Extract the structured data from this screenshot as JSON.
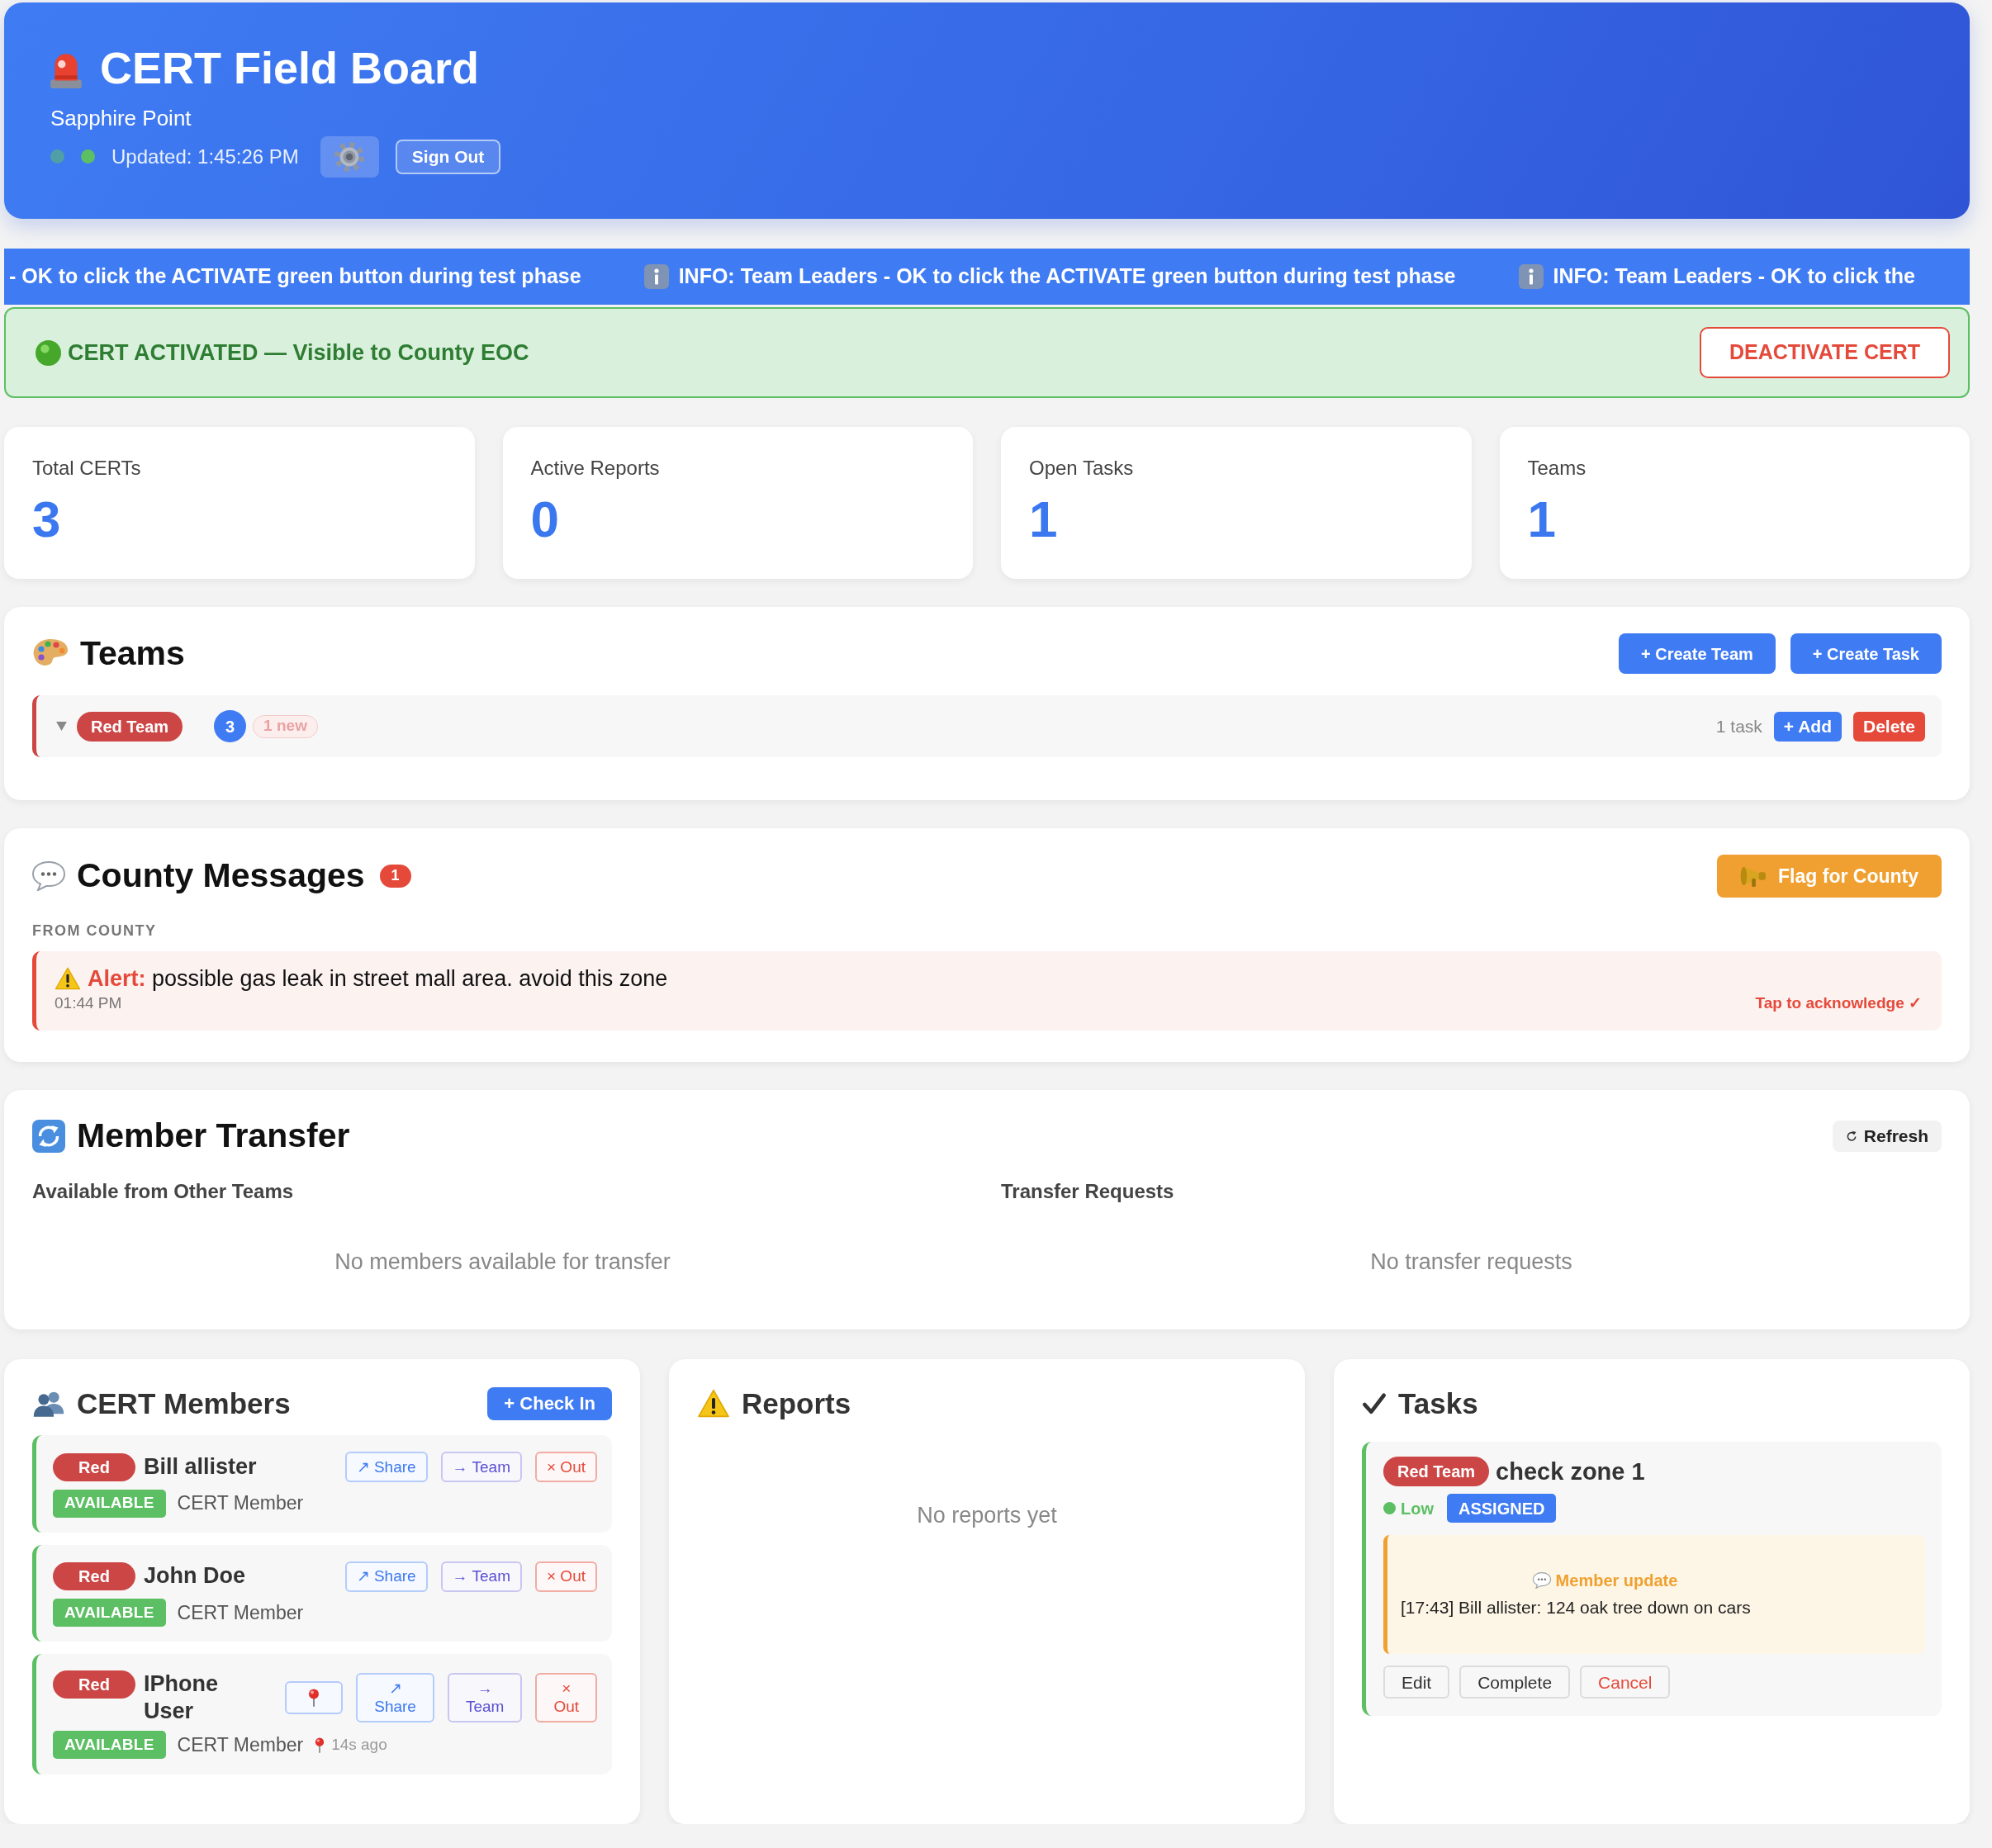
{
  "header": {
    "title": "CERT Field Board",
    "subtitle": "Sapphire Point",
    "status_dots": [
      {
        "color": "#4f9fa6"
      },
      {
        "color": "#5cbf63"
      }
    ],
    "updated": "Updated: 1:45:26 PM",
    "sign_out": "Sign Out"
  },
  "ticker": [
    {
      "kind": "plain",
      "text": "- OK to click the ACTIVATE green button during test phase"
    },
    {
      "kind": "info",
      "text": "INFO: Team Leaders - OK to click the ACTIVATE green button during test phase"
    },
    {
      "kind": "info",
      "text": "INFO: Team Leaders - OK to click the"
    }
  ],
  "activation": {
    "activated": true,
    "text": "CERT ACTIVATED — Visible to County EOC",
    "button": "DEACTIVATE CERT"
  },
  "stats": [
    {
      "label": "Total CERTs",
      "value": "3"
    },
    {
      "label": "Active Reports",
      "value": "0"
    },
    {
      "label": "Open Tasks",
      "value": "1"
    },
    {
      "label": "Teams",
      "value": "1"
    }
  ],
  "teams": {
    "title": "Teams",
    "buttons": [
      "+ Create Team",
      "+ Create Task"
    ],
    "items": [
      {
        "name": "Red Team",
        "color": "#cc4646",
        "members": "3",
        "new_badge": "1 new",
        "tasks": "1 task",
        "add_button": "+ Add",
        "delete_button": "Delete"
      }
    ]
  },
  "county_messages": {
    "title": "County Messages",
    "unread": "1",
    "flag_button": "Flag for County",
    "label": "FROM COUNTY",
    "messages": [
      {
        "kind": "alert",
        "text": "**Alert:** possible gas leak in street mall area. avoid this zone",
        "time": "01:44 PM",
        "acknowledge": "Tap to acknowledge ✓"
      }
    ]
  },
  "member_transfer": {
    "title": "Member Transfer",
    "refresh_button": "Refresh",
    "columns": [
      {
        "heading": "Available from Other Teams",
        "empty": "No members available for transfer"
      },
      {
        "heading": "Transfer Requests",
        "empty": "No transfer requests"
      }
    ]
  },
  "members": {
    "title": "CERT Members",
    "check_in_button": "+ Check In",
    "items": [
      {
        "team": "Red",
        "name": "Bill allister",
        "status": {
          "text": "AVAILABLE",
          "color": "#5cbf63"
        },
        "role": "CERT Member",
        "actions": [
          {
            "kind": "share",
            "label": "↗ Share"
          },
          {
            "kind": "transfer",
            "label": "→ Team"
          },
          {
            "kind": "checkout",
            "label": "× Out"
          }
        ]
      },
      {
        "team": "Red",
        "name": "John Doe",
        "status": {
          "text": "AVAILABLE",
          "color": "#5cbf63"
        },
        "role": "CERT Member",
        "actions": [
          {
            "kind": "share",
            "label": "↗ Share"
          },
          {
            "kind": "transfer",
            "label": "→ Team"
          },
          {
            "kind": "checkout",
            "label": "× Out"
          }
        ]
      },
      {
        "team": "Red",
        "name": "IPhone User",
        "status": {
          "text": "AVAILABLE",
          "color": "#5cbf63"
        },
        "role": "CERT Member",
        "location_age": "14s ago",
        "actions": [
          {
            "kind": "locate"
          },
          {
            "kind": "share",
            "label": "↗ Share"
          },
          {
            "kind": "transfer",
            "label": "→ Team"
          },
          {
            "kind": "checkout",
            "label": "× Out"
          }
        ]
      }
    ]
  },
  "reports": {
    "title": "Reports",
    "empty": "No reports yet"
  },
  "tasks": {
    "title": "Tasks",
    "items": [
      {
        "team": "Red Team",
        "title": "check zone 1",
        "priority": {
          "text": "Low",
          "color": "#5cbf63"
        },
        "status": {
          "text": "ASSIGNED",
          "color": "#3f7bf2"
        },
        "update": {
          "heading": "Member update",
          "text": "[17:43] Bill allister: 124 oak tree down on cars"
        },
        "buttons": [
          {
            "kind": "edit",
            "label": "Edit"
          },
          {
            "kind": "complete",
            "label": "Complete"
          },
          {
            "kind": "cancel",
            "label": "Cancel"
          }
        ]
      }
    ]
  }
}
